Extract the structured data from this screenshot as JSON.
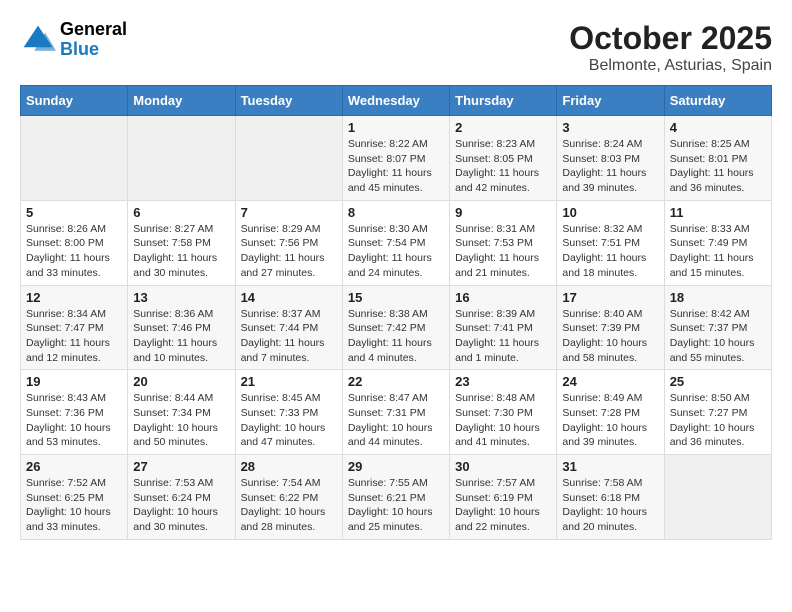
{
  "header": {
    "logo_general": "General",
    "logo_blue": "Blue",
    "month": "October 2025",
    "location": "Belmonte, Asturias, Spain"
  },
  "weekdays": [
    "Sunday",
    "Monday",
    "Tuesday",
    "Wednesday",
    "Thursday",
    "Friday",
    "Saturday"
  ],
  "weeks": [
    [
      {
        "day": "",
        "info": ""
      },
      {
        "day": "",
        "info": ""
      },
      {
        "day": "",
        "info": ""
      },
      {
        "day": "1",
        "info": "Sunrise: 8:22 AM\nSunset: 8:07 PM\nDaylight: 11 hours\nand 45 minutes."
      },
      {
        "day": "2",
        "info": "Sunrise: 8:23 AM\nSunset: 8:05 PM\nDaylight: 11 hours\nand 42 minutes."
      },
      {
        "day": "3",
        "info": "Sunrise: 8:24 AM\nSunset: 8:03 PM\nDaylight: 11 hours\nand 39 minutes."
      },
      {
        "day": "4",
        "info": "Sunrise: 8:25 AM\nSunset: 8:01 PM\nDaylight: 11 hours\nand 36 minutes."
      }
    ],
    [
      {
        "day": "5",
        "info": "Sunrise: 8:26 AM\nSunset: 8:00 PM\nDaylight: 11 hours\nand 33 minutes."
      },
      {
        "day": "6",
        "info": "Sunrise: 8:27 AM\nSunset: 7:58 PM\nDaylight: 11 hours\nand 30 minutes."
      },
      {
        "day": "7",
        "info": "Sunrise: 8:29 AM\nSunset: 7:56 PM\nDaylight: 11 hours\nand 27 minutes."
      },
      {
        "day": "8",
        "info": "Sunrise: 8:30 AM\nSunset: 7:54 PM\nDaylight: 11 hours\nand 24 minutes."
      },
      {
        "day": "9",
        "info": "Sunrise: 8:31 AM\nSunset: 7:53 PM\nDaylight: 11 hours\nand 21 minutes."
      },
      {
        "day": "10",
        "info": "Sunrise: 8:32 AM\nSunset: 7:51 PM\nDaylight: 11 hours\nand 18 minutes."
      },
      {
        "day": "11",
        "info": "Sunrise: 8:33 AM\nSunset: 7:49 PM\nDaylight: 11 hours\nand 15 minutes."
      }
    ],
    [
      {
        "day": "12",
        "info": "Sunrise: 8:34 AM\nSunset: 7:47 PM\nDaylight: 11 hours\nand 12 minutes."
      },
      {
        "day": "13",
        "info": "Sunrise: 8:36 AM\nSunset: 7:46 PM\nDaylight: 11 hours\nand 10 minutes."
      },
      {
        "day": "14",
        "info": "Sunrise: 8:37 AM\nSunset: 7:44 PM\nDaylight: 11 hours\nand 7 minutes."
      },
      {
        "day": "15",
        "info": "Sunrise: 8:38 AM\nSunset: 7:42 PM\nDaylight: 11 hours\nand 4 minutes."
      },
      {
        "day": "16",
        "info": "Sunrise: 8:39 AM\nSunset: 7:41 PM\nDaylight: 11 hours\nand 1 minute."
      },
      {
        "day": "17",
        "info": "Sunrise: 8:40 AM\nSunset: 7:39 PM\nDaylight: 10 hours\nand 58 minutes."
      },
      {
        "day": "18",
        "info": "Sunrise: 8:42 AM\nSunset: 7:37 PM\nDaylight: 10 hours\nand 55 minutes."
      }
    ],
    [
      {
        "day": "19",
        "info": "Sunrise: 8:43 AM\nSunset: 7:36 PM\nDaylight: 10 hours\nand 53 minutes."
      },
      {
        "day": "20",
        "info": "Sunrise: 8:44 AM\nSunset: 7:34 PM\nDaylight: 10 hours\nand 50 minutes."
      },
      {
        "day": "21",
        "info": "Sunrise: 8:45 AM\nSunset: 7:33 PM\nDaylight: 10 hours\nand 47 minutes."
      },
      {
        "day": "22",
        "info": "Sunrise: 8:47 AM\nSunset: 7:31 PM\nDaylight: 10 hours\nand 44 minutes."
      },
      {
        "day": "23",
        "info": "Sunrise: 8:48 AM\nSunset: 7:30 PM\nDaylight: 10 hours\nand 41 minutes."
      },
      {
        "day": "24",
        "info": "Sunrise: 8:49 AM\nSunset: 7:28 PM\nDaylight: 10 hours\nand 39 minutes."
      },
      {
        "day": "25",
        "info": "Sunrise: 8:50 AM\nSunset: 7:27 PM\nDaylight: 10 hours\nand 36 minutes."
      }
    ],
    [
      {
        "day": "26",
        "info": "Sunrise: 7:52 AM\nSunset: 6:25 PM\nDaylight: 10 hours\nand 33 minutes."
      },
      {
        "day": "27",
        "info": "Sunrise: 7:53 AM\nSunset: 6:24 PM\nDaylight: 10 hours\nand 30 minutes."
      },
      {
        "day": "28",
        "info": "Sunrise: 7:54 AM\nSunset: 6:22 PM\nDaylight: 10 hours\nand 28 minutes."
      },
      {
        "day": "29",
        "info": "Sunrise: 7:55 AM\nSunset: 6:21 PM\nDaylight: 10 hours\nand 25 minutes."
      },
      {
        "day": "30",
        "info": "Sunrise: 7:57 AM\nSunset: 6:19 PM\nDaylight: 10 hours\nand 22 minutes."
      },
      {
        "day": "31",
        "info": "Sunrise: 7:58 AM\nSunset: 6:18 PM\nDaylight: 10 hours\nand 20 minutes."
      },
      {
        "day": "",
        "info": ""
      }
    ]
  ]
}
